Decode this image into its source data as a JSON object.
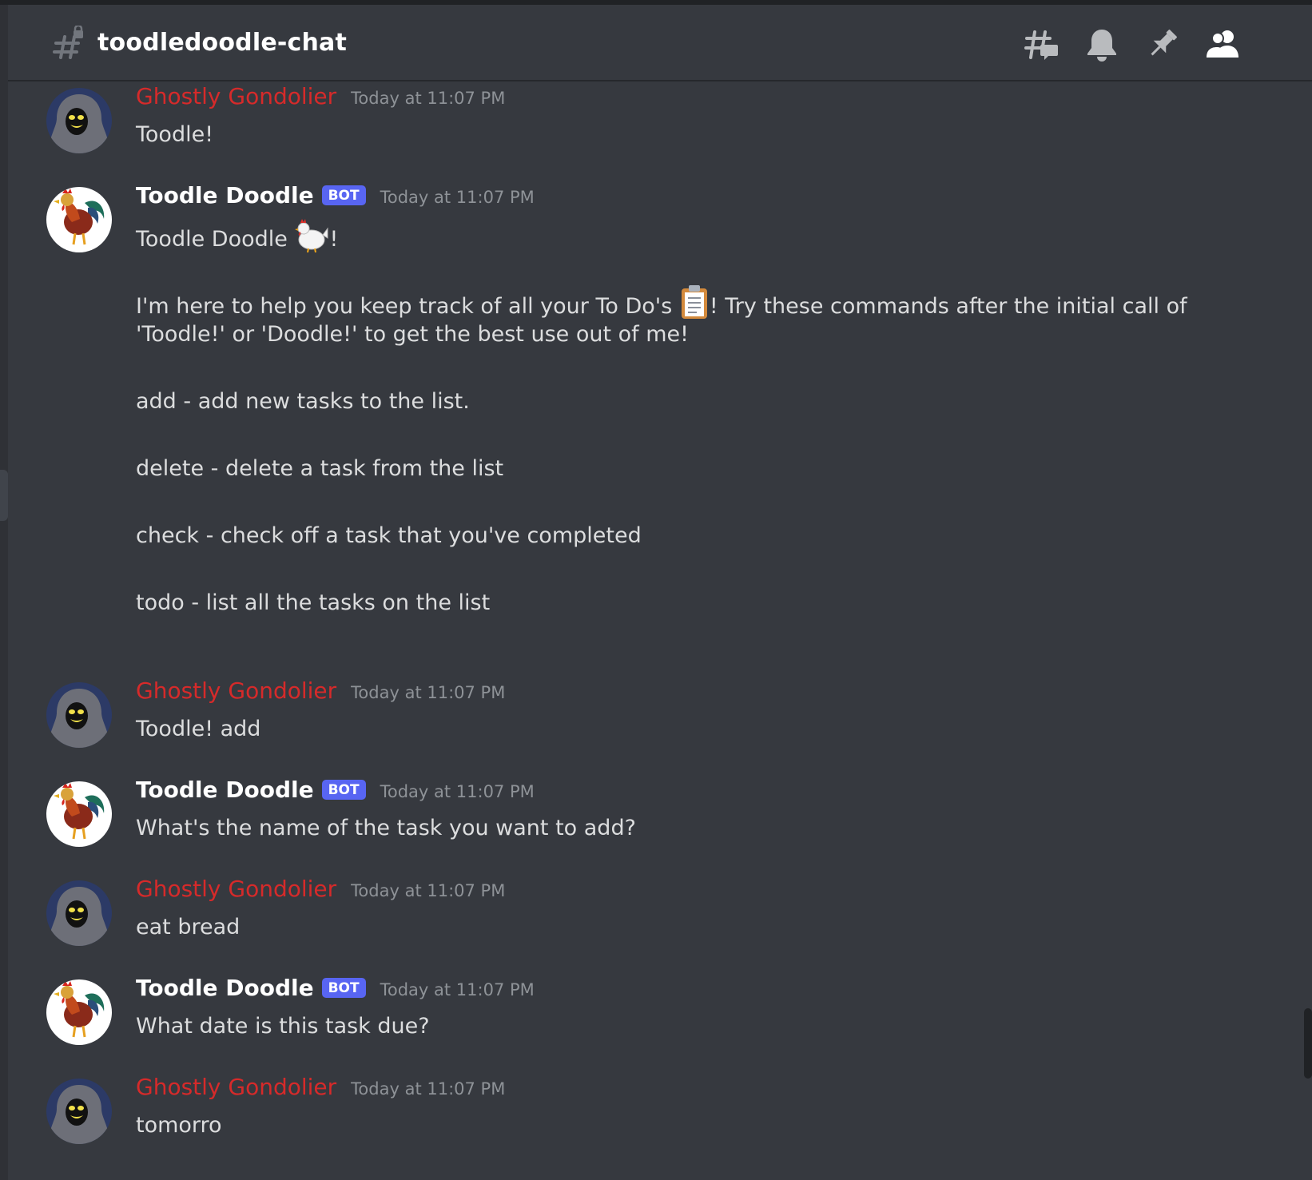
{
  "header": {
    "channel_name": "toodledoodle-chat",
    "icons": [
      "threads-icon",
      "bell-icon",
      "pin-icon",
      "members-icon"
    ]
  },
  "users": {
    "ghost": {
      "name": "Ghostly Gondolier",
      "color": "#d62a2a"
    },
    "bot": {
      "name": "Toodle Doodle",
      "tag": "BOT",
      "tag_color": "#5865f2"
    }
  },
  "messages": [
    {
      "author": "Ghostly Gondolier",
      "timestamp": "Today at 11:07 PM",
      "text": "Toodle!"
    },
    {
      "author": "Toodle Doodle",
      "bot_tag": "BOT",
      "timestamp": "Today at 11:07 PM",
      "line1_a": "Toodle Doodle ",
      "line1_b": "!",
      "para2_a": "I'm here to help you keep track of all your To Do's ",
      "para2_b": "! Try these commands after the initial call of",
      "para2_c": "'Toodle!' or 'Doodle!' to get the best use out of me!",
      "cmd_add": "add - add new tasks to the list.",
      "cmd_delete": "delete - delete a task from the list",
      "cmd_check": "check - check off a task that you've completed",
      "cmd_todo": "todo - list all the tasks on the list"
    },
    {
      "author": "Ghostly Gondolier",
      "timestamp": "Today at 11:07 PM",
      "text": "Toodle! add"
    },
    {
      "author": "Toodle Doodle",
      "bot_tag": "BOT",
      "timestamp": "Today at 11:07 PM",
      "text": "What's the name of the task you want to add?"
    },
    {
      "author": "Ghostly Gondolier",
      "timestamp": "Today at 11:07 PM",
      "text": "eat bread"
    },
    {
      "author": "Toodle Doodle",
      "bot_tag": "BOT",
      "timestamp": "Today at 11:07 PM",
      "text": "What date is this task due?"
    },
    {
      "author": "Ghostly Gondolier",
      "timestamp": "Today at 11:07 PM",
      "text": "tomorro"
    }
  ]
}
